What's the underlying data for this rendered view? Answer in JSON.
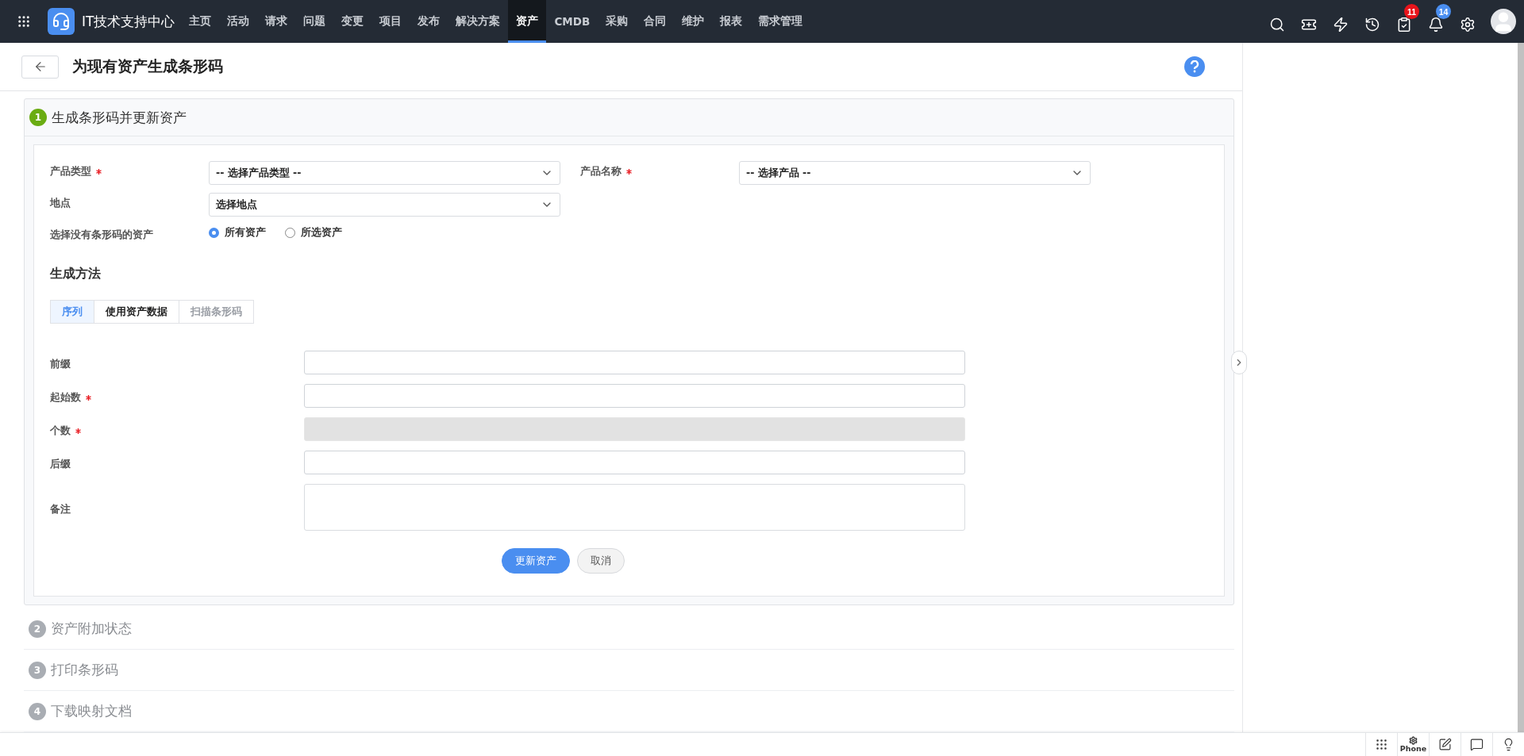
{
  "topbar": {
    "brand": "IT技术支持中心",
    "menu": [
      {
        "label": "主页",
        "selected": false
      },
      {
        "label": "活动",
        "selected": false
      },
      {
        "label": "请求",
        "selected": false
      },
      {
        "label": "问题",
        "selected": false
      },
      {
        "label": "变更",
        "selected": false
      },
      {
        "label": "项目",
        "selected": false
      },
      {
        "label": "发布",
        "selected": false
      },
      {
        "label": "解决方案",
        "selected": false
      },
      {
        "label": "资产",
        "selected": true
      },
      {
        "label": "CMDB",
        "selected": false
      },
      {
        "label": "采购",
        "selected": false
      },
      {
        "label": "合同",
        "selected": false
      },
      {
        "label": "维护",
        "selected": false
      },
      {
        "label": "报表",
        "selected": false
      },
      {
        "label": "需求管理",
        "selected": false
      }
    ],
    "tools": [
      {
        "kind": "search"
      },
      {
        "kind": "ticket"
      },
      {
        "kind": "bolt"
      },
      {
        "kind": "history"
      },
      {
        "kind": "tasks",
        "badge": "11",
        "color": "#e8141b"
      },
      {
        "kind": "bell",
        "badge": "14",
        "color": "#4a8ef0"
      },
      {
        "kind": "settings"
      }
    ]
  },
  "page": {
    "title": "为现有资产生成条形码"
  },
  "steps": [
    {
      "number": "1",
      "title": "生成条形码并更新资产",
      "expanded": true
    },
    {
      "number": "2",
      "title": "资产附加状态",
      "expanded": false
    },
    {
      "number": "3",
      "title": "打印条形码",
      "expanded": false
    },
    {
      "number": "4",
      "title": "下载映射文档",
      "expanded": false
    }
  ],
  "form": {
    "selects": [
      {
        "label": "产品类型",
        "required": true,
        "value": "-- 选择产品类型 --"
      },
      {
        "label": "产品名称",
        "required": true,
        "value": "-- 选择产品 --"
      },
      {
        "label": "地点",
        "required": false,
        "value": "选择地点"
      }
    ],
    "asset_filter": {
      "label": "选择没有条形码的资产",
      "options": [
        {
          "label": "所有资产",
          "selected": true
        },
        {
          "label": "所选资产",
          "selected": false
        }
      ]
    },
    "method_title": "生成方法",
    "method_tabs": [
      {
        "label": "序列",
        "selected": true,
        "disabled": false
      },
      {
        "label": "使用资产数据",
        "selected": false,
        "disabled": false
      },
      {
        "label": "扫描条形码",
        "selected": false,
        "disabled": true
      }
    ],
    "fields": [
      {
        "label": "前缀",
        "kind": "input",
        "required": false,
        "disabled": false
      },
      {
        "label": "起始数",
        "kind": "input",
        "required": true,
        "disabled": false
      },
      {
        "label": "个数",
        "kind": "input",
        "required": true,
        "disabled": true
      },
      {
        "label": "后缀",
        "kind": "input",
        "required": false,
        "disabled": false
      },
      {
        "label": "备注",
        "kind": "textarea",
        "required": false,
        "disabled": false
      }
    ],
    "buttons": [
      {
        "label": "更新资产",
        "kind": "primary"
      },
      {
        "label": "取消",
        "kind": "secondary"
      }
    ]
  },
  "bottom_bar": [
    {
      "kind": "dialpad"
    },
    {
      "kind": "phone",
      "label": "Phone"
    },
    {
      "kind": "note"
    },
    {
      "kind": "chat"
    },
    {
      "kind": "idea"
    }
  ]
}
